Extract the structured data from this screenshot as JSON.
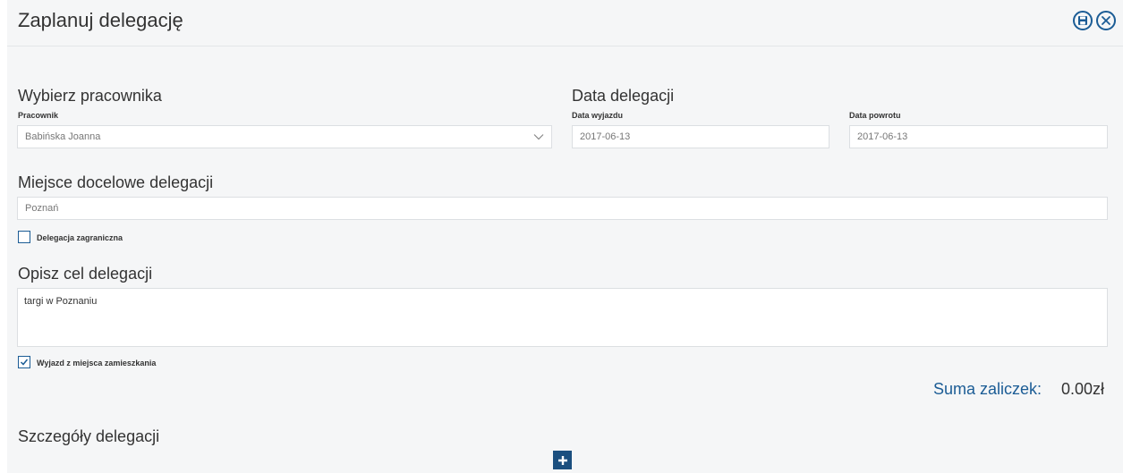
{
  "header": {
    "title": "Zaplanuj delegację",
    "save_icon": "floppy-disk-icon",
    "close_icon": "close-icon"
  },
  "employee": {
    "section_title": "Wybierz pracownika",
    "label": "Pracownik",
    "value": "Babińska Joanna"
  },
  "dates": {
    "section_title": "Data delegacji",
    "departure_label": "Data wyjazdu",
    "departure_value": "2017-06-13",
    "return_label": "Data powrotu",
    "return_value": "2017-06-13"
  },
  "destination": {
    "section_title": "Miejsce docelowe delegacji",
    "value": "Poznań",
    "foreign_label": "Delegacja zagraniczna",
    "foreign_checked": false
  },
  "purpose": {
    "section_title": "Opisz cel delegacji",
    "value": "targi w Poznaniu",
    "from_home_label": "Wyjazd z miejsca zamieszkania",
    "from_home_checked": true
  },
  "advances": {
    "label": "Suma zaliczek:",
    "value": "0.00zł"
  },
  "details": {
    "section_title": "Szczegóły delegacji",
    "add_icon": "plus-icon"
  },
  "colors": {
    "accent": "#1b5c95",
    "panel_bg": "#f5f6f7"
  }
}
